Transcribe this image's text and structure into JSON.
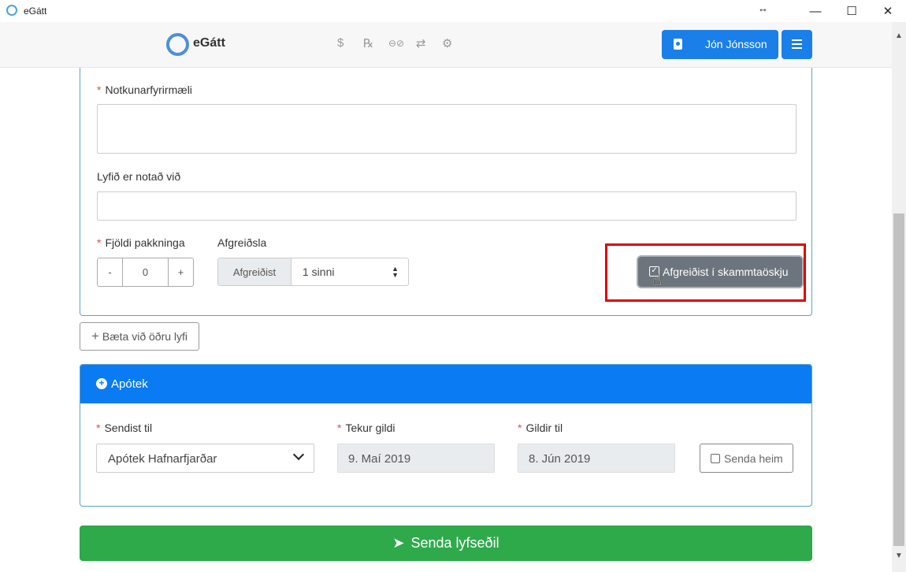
{
  "window": {
    "title": "eGátt",
    "resize_glyph": "↔",
    "controls": {
      "minimize": "—",
      "maximize": "☐",
      "close": "✕"
    }
  },
  "header": {
    "logo_text": "eGátt",
    "nav_icons": [
      {
        "name": "dollar-icon",
        "glyph": "$"
      },
      {
        "name": "prescription-icon",
        "glyph": "℞"
      },
      {
        "name": "glasses-icon",
        "glyph": "⊖⊘"
      },
      {
        "name": "exchange-icon",
        "glyph": "⇄"
      },
      {
        "name": "settings-icon",
        "glyph": "⚙"
      }
    ],
    "user_name": "Jón Jónsson",
    "accent_color": "#1a7fe8"
  },
  "medication": {
    "usage_label": "Notkunarfyrirmæli",
    "usage_value": "",
    "used_for_label": "Lyfið er notað við",
    "used_for_value": "",
    "package_count_label": "Fjöldi pakkninga",
    "stepper": {
      "minus": "-",
      "value": "0",
      "plus": "+"
    },
    "dispensing_label": "Afgreiðsla",
    "dispensing_prefix": "Afgreiðist",
    "dispensing_value": "1 sinni",
    "select_arrows": "▲▼",
    "dose_box_button": "Afgreiðist í skammtaöskju",
    "dose_box_check": "✓",
    "cursor_glyph": "☝"
  },
  "add_drug": {
    "plus": "+",
    "label": "Bæta við öðru lyfi"
  },
  "pharmacy": {
    "header_icon": "+",
    "header_label": "Apótek",
    "send_to_label": "Sendist til",
    "send_to_value": "Apótek Hafnarfjarðar",
    "effective_label": "Tekur gildi",
    "effective_value": "9. Maí 2019",
    "valid_until_label": "Gildir til",
    "valid_until_value": "8. Jún 2019",
    "send_home_label": "Senda heim",
    "header_color": "#0a7bf2"
  },
  "submit": {
    "icon": "➤",
    "label": "Senda lyfseðil",
    "color": "#2eaa4b"
  },
  "scrollbar": {
    "up": "▲",
    "down": "▼"
  }
}
